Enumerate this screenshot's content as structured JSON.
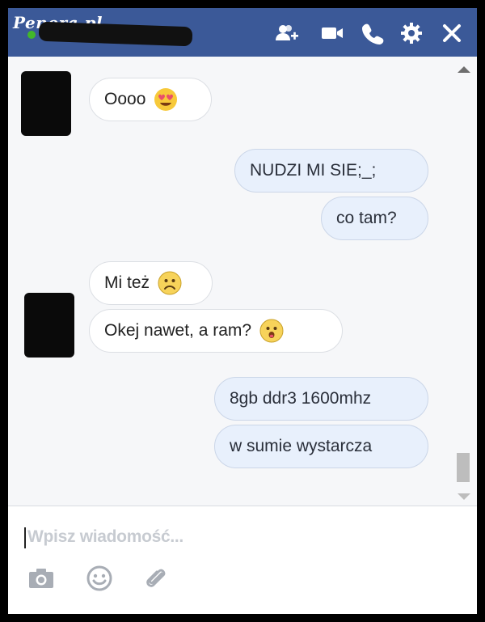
{
  "watermark": "Penera.pl",
  "header": {
    "bg_color": "#3b5998",
    "status_color": "#42b72a",
    "icons": [
      "add-friend-icon",
      "video-call-icon",
      "phone-icon",
      "gear-icon",
      "close-icon"
    ]
  },
  "messages": [
    {
      "side": "in",
      "text": "Oooo",
      "emoji": "heart-eyes-emoji"
    },
    {
      "side": "out",
      "text": "NUDZI MI SIE;_;"
    },
    {
      "side": "out",
      "text": "co tam?"
    },
    {
      "side": "in",
      "text": "Mi też",
      "emoji": "frown-emoji"
    },
    {
      "side": "in",
      "text": "Okej nawet, a ram?",
      "emoji": "surprised-emoji"
    },
    {
      "side": "out",
      "text": "8gb ddr3 1600mhz"
    },
    {
      "side": "out",
      "text": "w sumie wystarcza"
    }
  ],
  "composer": {
    "placeholder": "Wpisz wiadomość...",
    "tools": [
      "camera-icon",
      "emoji-icon",
      "attachment-icon"
    ]
  }
}
